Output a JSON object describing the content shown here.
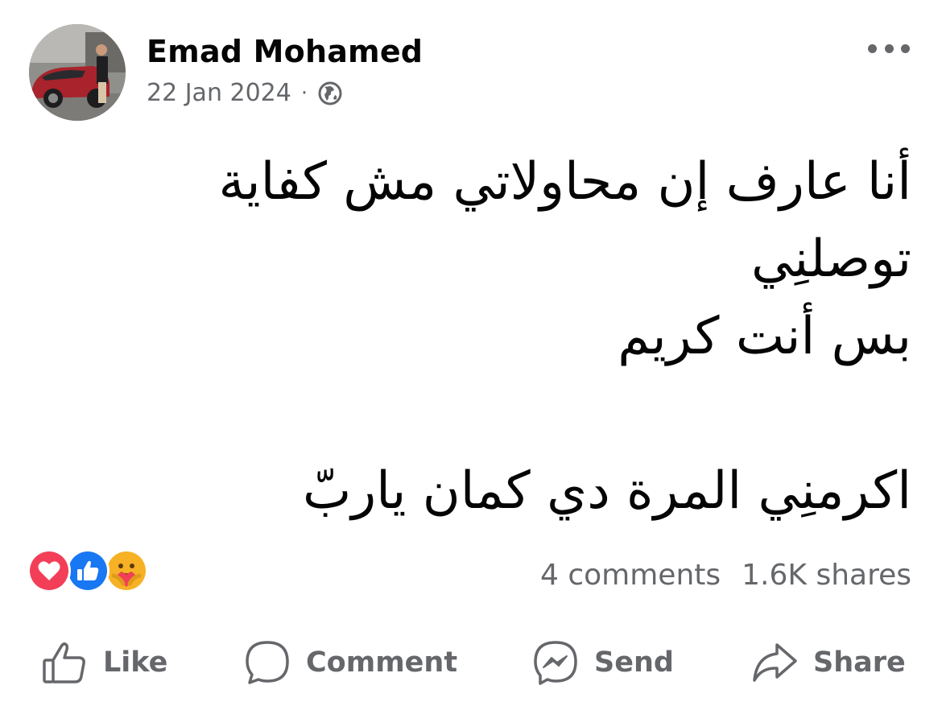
{
  "post": {
    "author": "Emad Mohamed",
    "date": "22 Jan 2024",
    "separator": "·",
    "privacy_icon": "globe-icon",
    "more_icon": "more-options-icon",
    "text_lines": [
      "أنا عارف إن محاولاتي مش كفاية",
      "توصلنِي",
      "بس أنت كريم",
      "",
      "اكرمنِي المرة دي كمان ياربّ"
    ]
  },
  "reactions": {
    "icons": [
      "love-reaction-icon",
      "like-reaction-icon",
      "care-reaction-icon"
    ],
    "comments": "4 comments",
    "shares": "1.6K shares"
  },
  "actions": {
    "like": "Like",
    "comment": "Comment",
    "send": "Send",
    "share": "Share"
  },
  "colors": {
    "secondary_text": "#65676b",
    "primary_text": "#050505",
    "love": "#f33e58",
    "like": "#1877f2",
    "care": "#f7b125"
  }
}
